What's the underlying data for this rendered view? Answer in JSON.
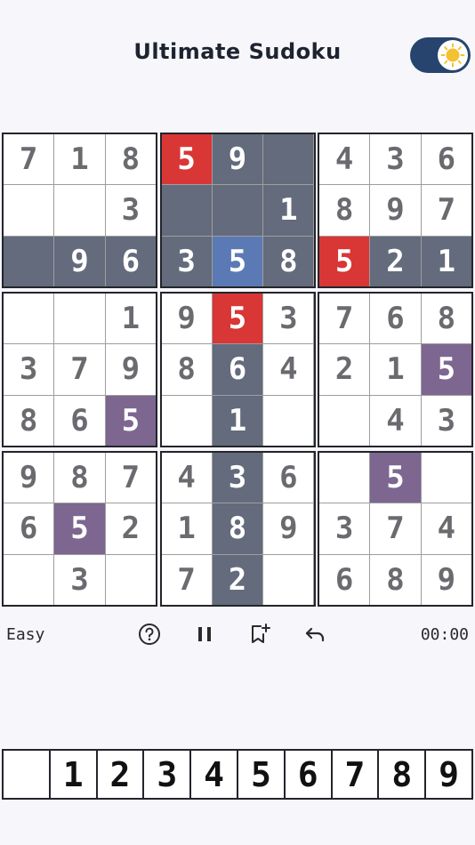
{
  "app": {
    "title": "Ultimate Sudoku"
  },
  "theme_toggle": {
    "state": "light",
    "icon": "sun-icon"
  },
  "colors": {
    "highlight": "#636b7c",
    "conflict": "#d93636",
    "selected": "#5b7ab5",
    "same_number": "#7d6690",
    "toggle_bg": "#26446e",
    "sun": "#f2c230"
  },
  "board": {
    "selected_cell": {
      "row": 2,
      "col": 4,
      "value": "5"
    },
    "grid": [
      [
        "7",
        "1",
        "8",
        "5",
        "9",
        "",
        "4",
        "3",
        "6"
      ],
      [
        "",
        "",
        "3",
        "",
        "",
        "1",
        "8",
        "9",
        "7"
      ],
      [
        "",
        "9",
        "6",
        "3",
        "5",
        "8",
        "5",
        "2",
        "1"
      ],
      [
        "",
        "",
        "1",
        "9",
        "5",
        "3",
        "7",
        "6",
        "8"
      ],
      [
        "3",
        "7",
        "9",
        "8",
        "6",
        "4",
        "2",
        "1",
        "5"
      ],
      [
        "8",
        "6",
        "5",
        "",
        "1",
        "",
        "",
        "4",
        "3"
      ],
      [
        "9",
        "8",
        "7",
        "4",
        "3",
        "6",
        "",
        "5",
        ""
      ],
      [
        "6",
        "5",
        "2",
        "1",
        "8",
        "9",
        "3",
        "7",
        "4"
      ],
      [
        "",
        "3",
        "",
        "7",
        "2",
        "",
        "6",
        "8",
        "9"
      ]
    ],
    "cell_states": [
      [
        "",
        "",
        "",
        "r",
        "h",
        "h",
        "",
        "",
        ""
      ],
      [
        "",
        "",
        "",
        "h",
        "h",
        "h",
        "",
        "",
        ""
      ],
      [
        "h",
        "h",
        "h",
        "h",
        "b",
        "h",
        "r",
        "h",
        "h"
      ],
      [
        "",
        "",
        "",
        "",
        "r",
        "",
        "",
        "",
        ""
      ],
      [
        "",
        "",
        "",
        "",
        "h",
        "",
        "",
        "",
        "p"
      ],
      [
        "",
        "",
        "p",
        "",
        "h",
        "",
        "",
        "",
        ""
      ],
      [
        "",
        "",
        "",
        "",
        "h",
        "",
        "",
        "p",
        ""
      ],
      [
        "",
        "p",
        "",
        "",
        "h",
        "",
        "",
        "",
        ""
      ],
      [
        "",
        "",
        "",
        "",
        "h",
        "",
        "",
        "",
        ""
      ]
    ]
  },
  "toolbar": {
    "difficulty": "Easy",
    "timer": "00:00",
    "tools": [
      "help-icon",
      "pause-icon",
      "bookmark-add-icon",
      "undo-icon"
    ]
  },
  "numpad": {
    "keys": [
      "",
      "1",
      "2",
      "3",
      "4",
      "5",
      "6",
      "7",
      "8",
      "9"
    ]
  }
}
